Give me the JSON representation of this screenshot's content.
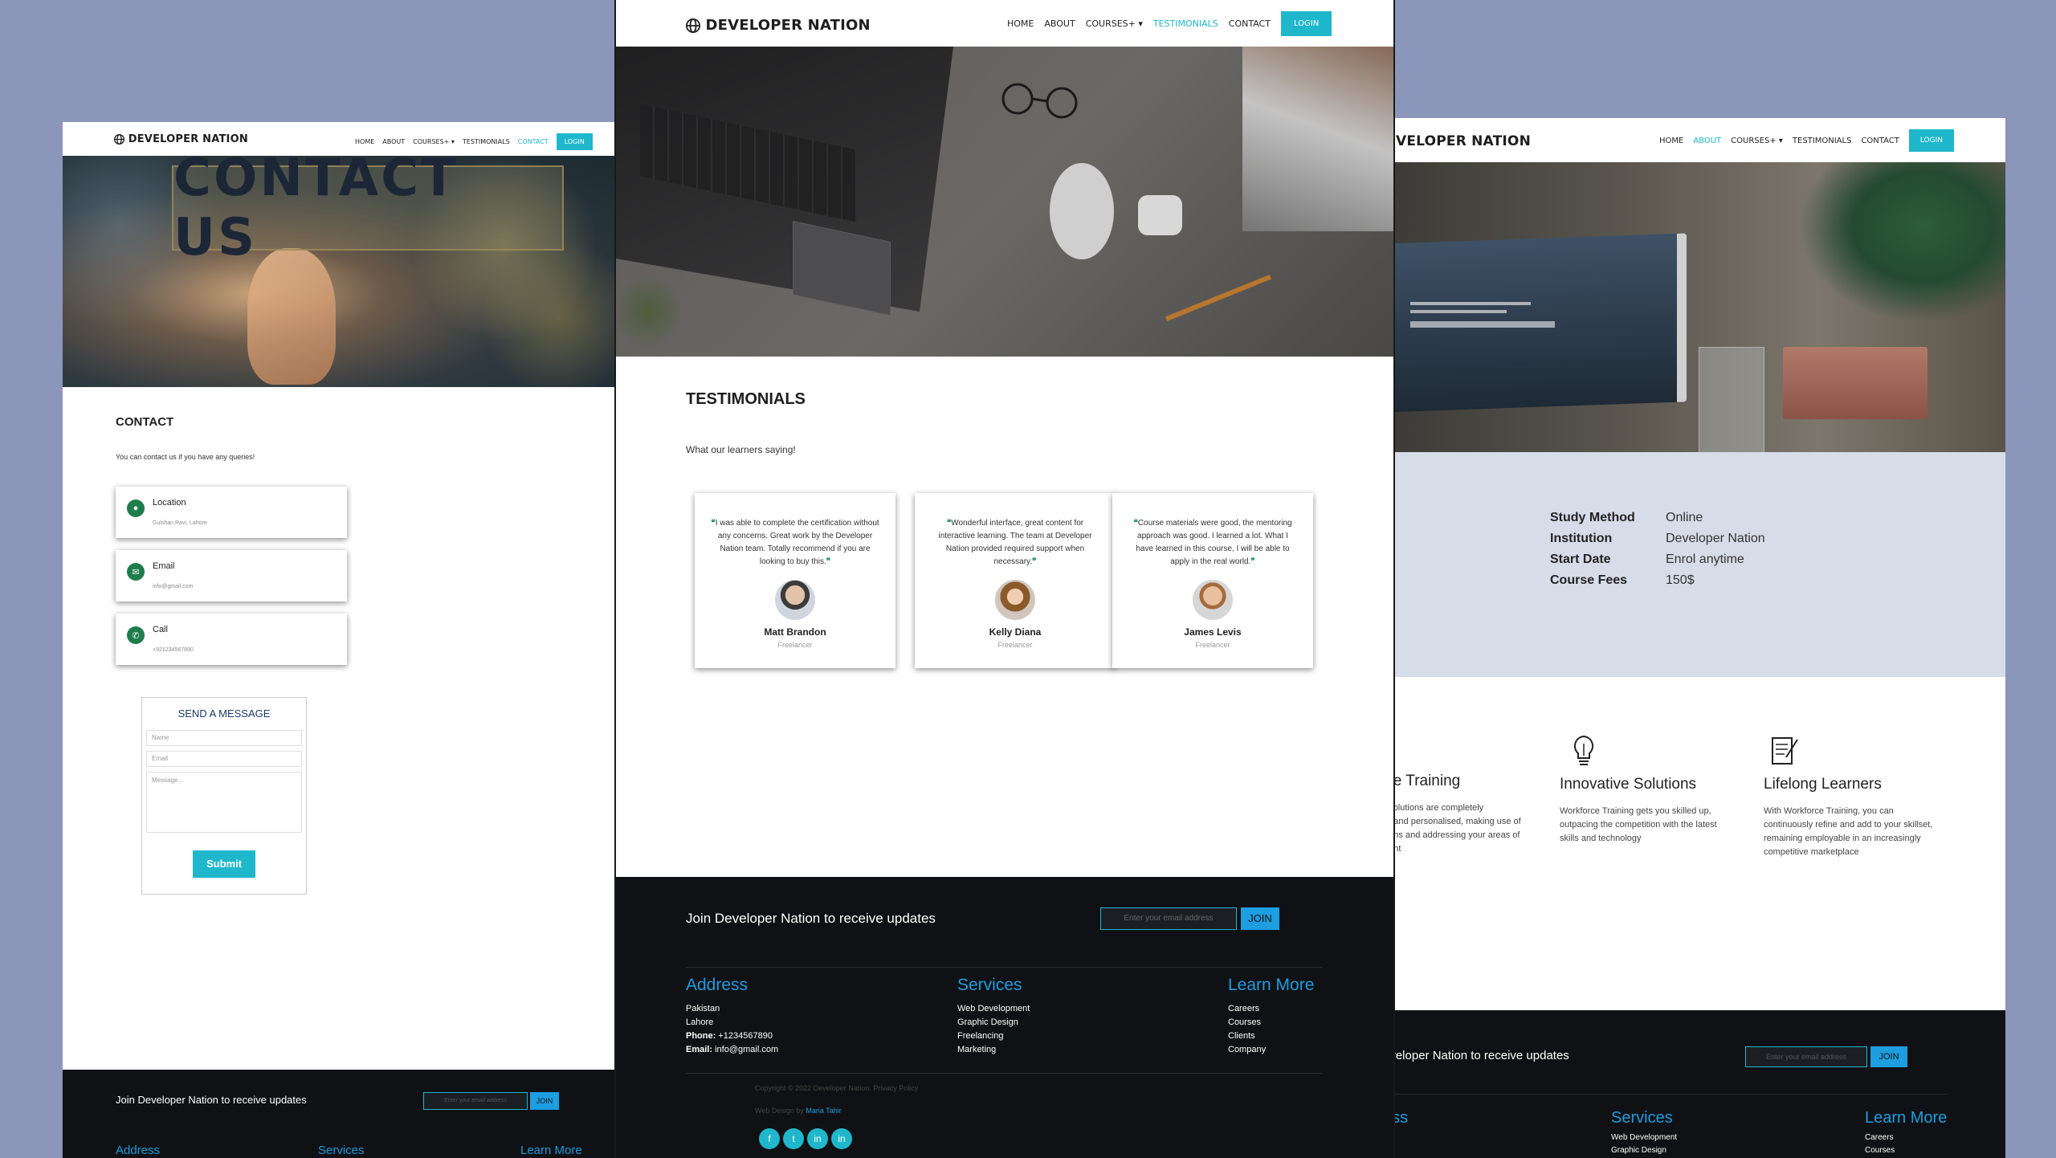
{
  "brand": "DEVELOPER NATION",
  "brand_partial": "VELOPER NATION",
  "nav": {
    "home": "HOME",
    "about": "ABOUT",
    "courses": "COURSES+",
    "testimonials": "TESTIMONIALS",
    "contact": "CONTACT",
    "login": "LOGIN"
  },
  "colors": {
    "accent": "#1fb7cc",
    "link_blue": "#1d9ee0",
    "dark": "#101114",
    "bg": "#8b96bb",
    "info_band": "#d6dde8"
  },
  "contact": {
    "hero_title": "CONTACT US",
    "heading": "CONTACT",
    "intro": "You can contact us if you have any queries!",
    "cards": [
      {
        "title": "Location",
        "value": "Gulshan Ravi, Lahore",
        "icon": "location-pin-icon"
      },
      {
        "title": "Email",
        "value": "info@gmail.com",
        "icon": "envelope-icon"
      },
      {
        "title": "Call",
        "value": "+921234567890",
        "icon": "phone-icon"
      }
    ],
    "form": {
      "title": "SEND A MESSAGE",
      "name": "Name",
      "email": "Email",
      "message": "Message...",
      "submit": "Submit"
    }
  },
  "testimonials": {
    "heading": "TESTIMONIALS",
    "subheading": "What our learners saying!",
    "items": [
      {
        "quote": "I was able to complete the certification without any concerns. Great work by the Developer Nation team. Totally recommend if you are looking to buy this.",
        "name": "Matt Brandon",
        "role": "Freelancer"
      },
      {
        "quote": "Wonderful interface, great content for interactive learning. The team at Developer Nation provided required support when necessary.",
        "name": "Kelly Diana",
        "role": "Freelancer"
      },
      {
        "quote": "Course materials were good, the mentoring approach was good. I learned a lot. What I have learned in this course, I will be able to apply in the real world.",
        "name": "James Levis",
        "role": "Freelancer"
      }
    ]
  },
  "about": {
    "info": [
      {
        "label": "Study Method",
        "value": "Online"
      },
      {
        "label": "Institution",
        "value": "Developer Nation"
      },
      {
        "label": "Start Date",
        "value": "Enrol anytime"
      },
      {
        "label": "Course Fees",
        "value": "150$"
      }
    ],
    "features": [
      {
        "title": "ble Training",
        "lines": [
          "g solutions are completely",
          "ed and personalised, making use of",
          "ngths and addressing your areas of",
          "ment"
        ],
        "icon": ""
      },
      {
        "title": "Innovative Solutions",
        "lines": [
          "Workforce Training gets you skilled up,",
          "outpacing the competition with the latest",
          "skills and technology"
        ],
        "icon": "lightbulb-icon"
      },
      {
        "title": "Lifelong Learners",
        "lines": [
          "With Workforce Training, you can",
          "continuously refine and add to your skillset,",
          "remaining employable in an increasingly",
          "competitive marketplace"
        ],
        "icon": "notepad-icon"
      }
    ]
  },
  "footer": {
    "join_text": "Join Developer Nation to receive updates",
    "join_text_partial": "eveloper Nation to receive updates",
    "email_placeholder": "Enter your email address",
    "join_button": "JOIN",
    "address_title": "Address",
    "address_title_partial": "ess",
    "address_lines": [
      "Pakistan",
      "Lahore"
    ],
    "phone_label": "Phone:",
    "phone": "+1234567890",
    "email_label": "Email:",
    "email": "info@gmail.com",
    "services_title": "Services",
    "services": [
      "Web Development",
      "Graphic Design",
      "Freelancing",
      "Marketing"
    ],
    "learn_title": "Learn More",
    "learn": [
      "Careers",
      "Courses",
      "Clients",
      "Company"
    ],
    "copyright": "Copyright © 2022 Developer Nation. Privacy Policy",
    "design_by": "Web Design by",
    "designer": "Maria Tahir",
    "social": [
      "f",
      "t",
      "in",
      "in"
    ]
  }
}
